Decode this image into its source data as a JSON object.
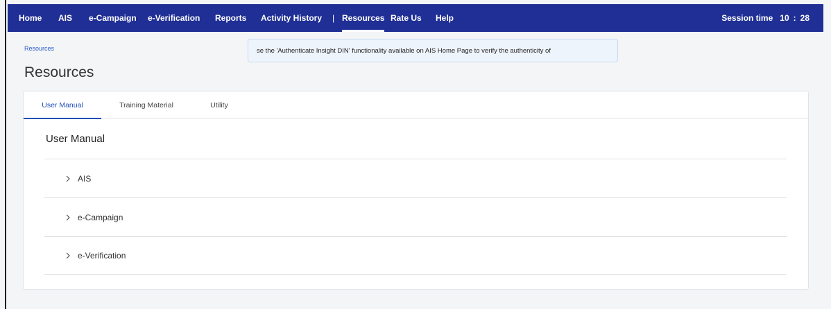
{
  "nav": {
    "items": [
      {
        "label": "Home"
      },
      {
        "label": "AIS"
      },
      {
        "label": "e-Campaign"
      },
      {
        "label": "e-Verification"
      },
      {
        "label": "Reports"
      },
      {
        "label": "Activity History"
      },
      {
        "label": "Resources"
      },
      {
        "label": "Rate Us"
      },
      {
        "label": "Help"
      }
    ],
    "separator": "|",
    "active": "Resources"
  },
  "session": {
    "label": "Session time",
    "minutes": "10",
    "colon": ":",
    "seconds": "28"
  },
  "breadcrumb": "Resources",
  "page_title": "Resources",
  "banner_text": "se the 'Authenticate Insight DIN' functionality available on AIS Home Page to verify the authenticity of",
  "tabs": [
    {
      "label": "User Manual"
    },
    {
      "label": "Training Material"
    },
    {
      "label": "Utility"
    }
  ],
  "section_title": "User Manual",
  "accordion": [
    {
      "label": "AIS"
    },
    {
      "label": "e-Campaign"
    },
    {
      "label": "e-Verification"
    }
  ],
  "colors": {
    "nav_bg": "#1f2f95",
    "accent": "#1f4fb8",
    "link": "#2a60c9"
  }
}
